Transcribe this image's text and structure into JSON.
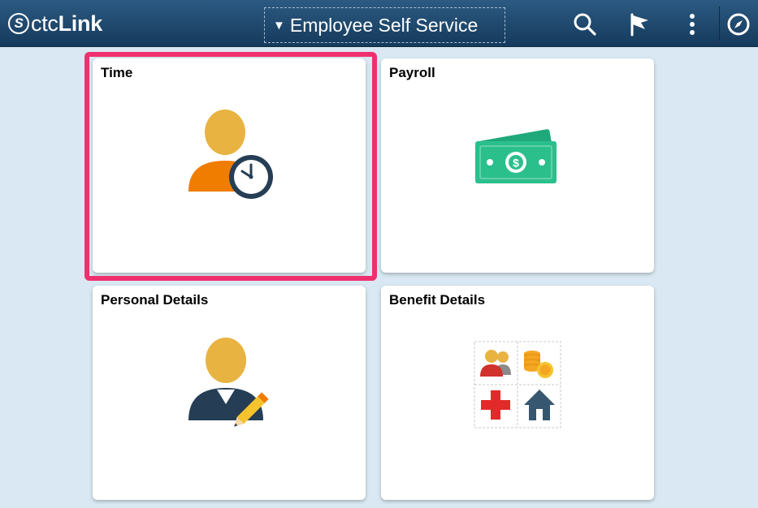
{
  "header": {
    "logo_mark": "S",
    "logo_light": "ctc",
    "logo_bold": "Link",
    "homepage_selector": "Employee Self Service",
    "icons": [
      "search-icon",
      "flag-icon",
      "actions-menu-icon",
      "navbar-compass-icon"
    ]
  },
  "tiles": [
    {
      "title": "Time",
      "icon": "person-clock-icon",
      "highlighted": true
    },
    {
      "title": "Payroll",
      "icon": "money-icon"
    },
    {
      "title": "Personal Details",
      "icon": "person-pencil-icon"
    },
    {
      "title": "Benefit Details",
      "icon": "benefits-grid-icon"
    }
  ],
  "colors": {
    "header": "#1f4a70",
    "background": "#d9e8f2",
    "highlight": "#f0306e",
    "person": "#e8b341",
    "shirt_orange": "#f07c00",
    "navy": "#253e55",
    "money": "#2bbf8c"
  }
}
